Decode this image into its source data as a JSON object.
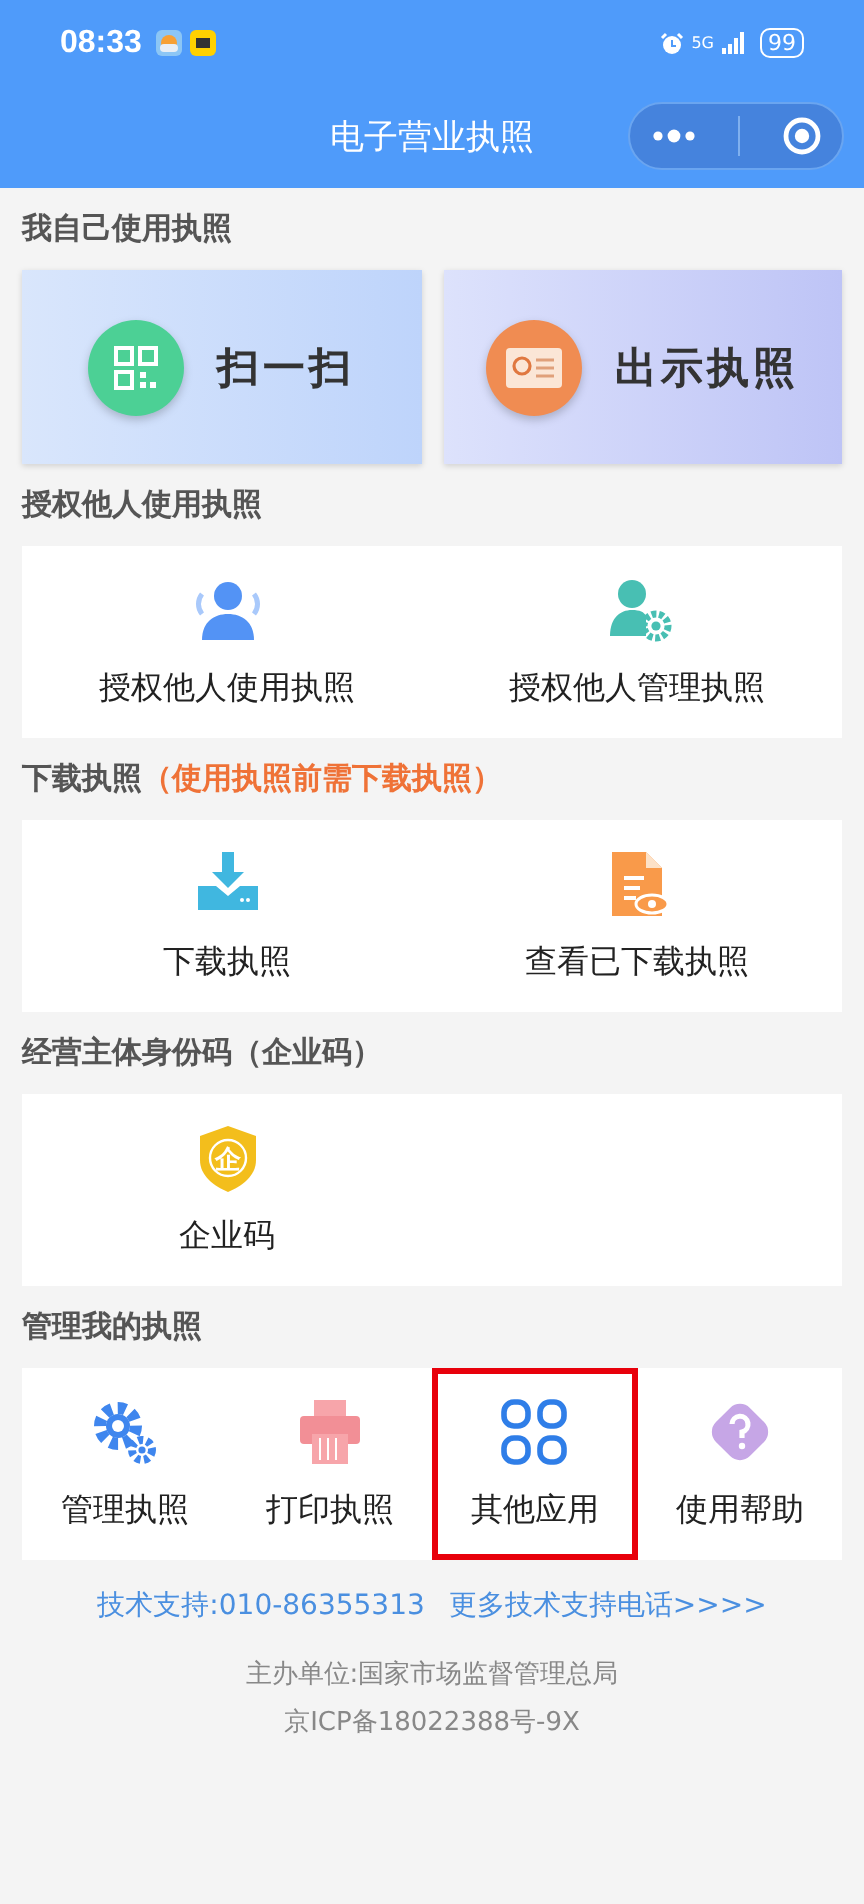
{
  "status_bar": {
    "time": "08:33",
    "network": "5G",
    "battery": "99"
  },
  "nav": {
    "title": "电子营业执照"
  },
  "sections": [
    {
      "title": "我自己使用执照",
      "kind": "big",
      "items": [
        {
          "label": "扫一扫",
          "kind": "qr"
        },
        {
          "label": "出示执照",
          "kind": "license"
        }
      ]
    },
    {
      "title": "授权他人使用执照",
      "kind": "grid",
      "items": [
        {
          "label": "授权他人使用执照",
          "kind": "people",
          "selected": false
        },
        {
          "label": "授权他人管理执照",
          "kind": "person-gear",
          "selected": false
        }
      ]
    },
    {
      "title": "下载执照",
      "note": "（使用执照前需下载执照）",
      "kind": "grid",
      "items": [
        {
          "label": "下载执照",
          "kind": "download",
          "selected": false
        },
        {
          "label": "查看已下载执照",
          "kind": "doc-eye",
          "selected": false
        }
      ]
    },
    {
      "title": "经营主体身份码（企业码）",
      "kind": "grid",
      "items": [
        {
          "label": "企业码",
          "kind": "shield",
          "glyph": "企",
          "selected": false
        }
      ]
    },
    {
      "title": "管理我的执照",
      "kind": "toolbar",
      "items": [
        {
          "label": "管理执照",
          "kind": "gears",
          "selected": false
        },
        {
          "label": "打印执照",
          "kind": "printer",
          "selected": false
        },
        {
          "label": "其他应用",
          "kind": "apps",
          "selected": true
        },
        {
          "label": "使用帮助",
          "kind": "help",
          "selected": false
        }
      ]
    }
  ],
  "footer": {
    "support": "技术支持:010-86355313",
    "more_link": "更多技术支持电话>>>>",
    "sponsor": "主办单位:国家市场监督管理总局",
    "icp": "京ICP备18022388号-9X"
  }
}
